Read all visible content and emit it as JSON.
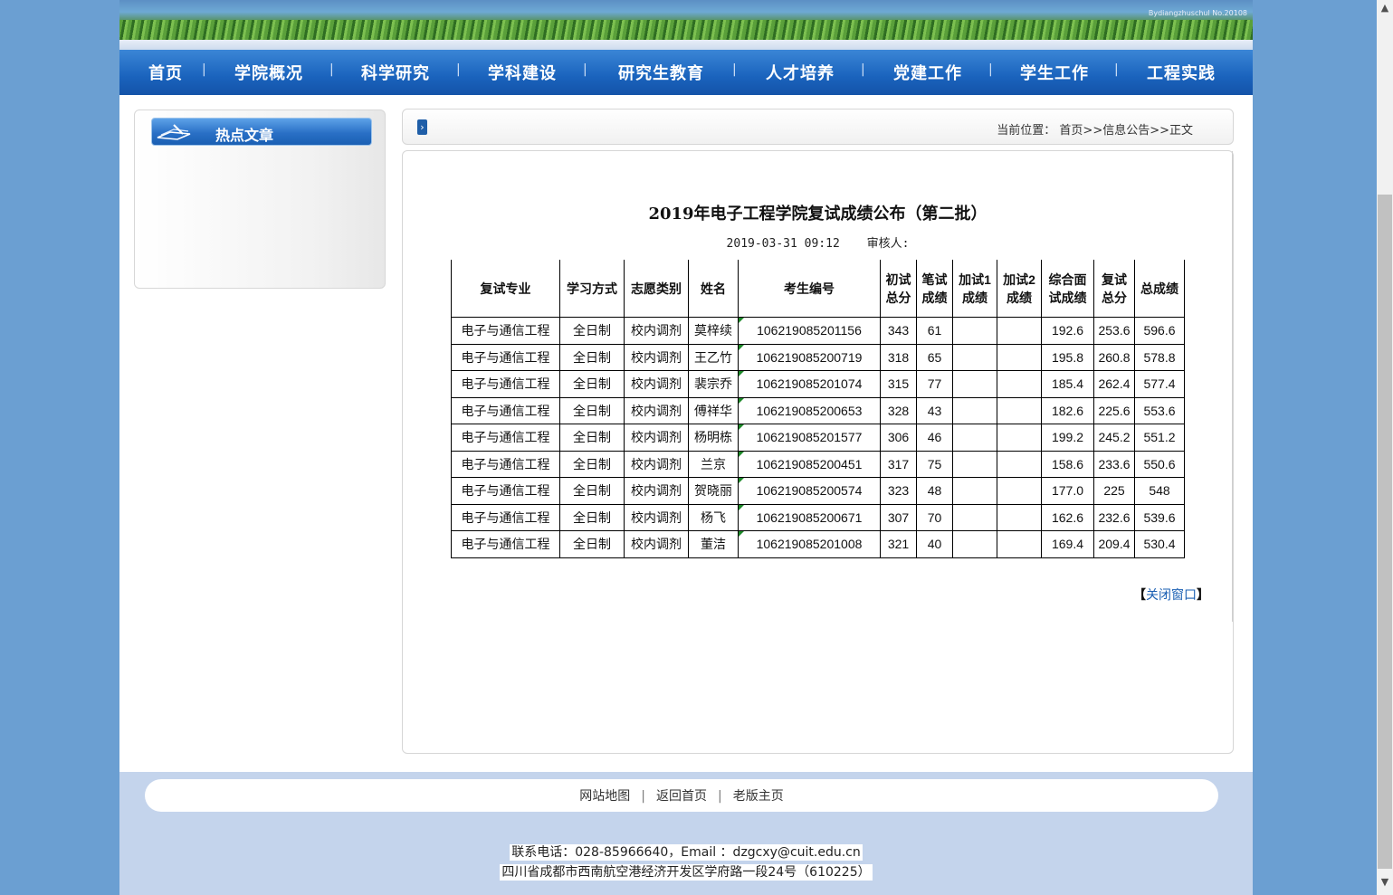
{
  "banner": {
    "tag": "Bydiangzhuschul No.20108"
  },
  "nav": {
    "items": [
      "首页",
      "学院概况",
      "科学研究",
      "学科建设",
      "研究生教育",
      "人才培养",
      "党建工作",
      "学生工作",
      "工程实践"
    ],
    "separator": "|"
  },
  "sidebar": {
    "title": "热点文章"
  },
  "breadcrumb": {
    "label": "当前位置：",
    "path": "首页>>信息公告>>正文"
  },
  "article": {
    "title": "2019年电子工程学院复试成绩公布（第二批）",
    "date": "2019-03-31 09:12",
    "reviewer": "审核人:",
    "close_open": "【",
    "close_label": "关闭窗口",
    "close_end": "】"
  },
  "table": {
    "headers": [
      "复试专业",
      "学习方式",
      "志愿类别",
      "姓名",
      "考生编号",
      "初试总分",
      "笔试成绩",
      "加试1成绩",
      "加试2成绩",
      "综合面试成绩",
      "复试总分",
      "总成绩"
    ],
    "rows": [
      [
        "电子与通信工程",
        "全日制",
        "校内调剂",
        "莫梓续",
        "106219085201156",
        "343",
        "61",
        "",
        "",
        "192.6",
        "253.6",
        "596.6"
      ],
      [
        "电子与通信工程",
        "全日制",
        "校内调剂",
        "王乙竹",
        "106219085200719",
        "318",
        "65",
        "",
        "",
        "195.8",
        "260.8",
        "578.8"
      ],
      [
        "电子与通信工程",
        "全日制",
        "校内调剂",
        "裴宗乔",
        "106219085201074",
        "315",
        "77",
        "",
        "",
        "185.4",
        "262.4",
        "577.4"
      ],
      [
        "电子与通信工程",
        "全日制",
        "校内调剂",
        "傅祥华",
        "106219085200653",
        "328",
        "43",
        "",
        "",
        "182.6",
        "225.6",
        "553.6"
      ],
      [
        "电子与通信工程",
        "全日制",
        "校内调剂",
        "杨明栋",
        "106219085201577",
        "306",
        "46",
        "",
        "",
        "199.2",
        "245.2",
        "551.2"
      ],
      [
        "电子与通信工程",
        "全日制",
        "校内调剂",
        "兰京",
        "106219085200451",
        "317",
        "75",
        "",
        "",
        "158.6",
        "233.6",
        "550.6"
      ],
      [
        "电子与通信工程",
        "全日制",
        "校内调剂",
        "贺晓丽",
        "106219085200574",
        "323",
        "48",
        "",
        "",
        "177.0",
        "225",
        "548"
      ],
      [
        "电子与通信工程",
        "全日制",
        "校内调剂",
        "杨飞",
        "106219085200671",
        "307",
        "70",
        "",
        "",
        "162.6",
        "232.6",
        "539.6"
      ],
      [
        "电子与通信工程",
        "全日制",
        "校内调剂",
        "董洁",
        "106219085201008",
        "321",
        "40",
        "",
        "",
        "169.4",
        "209.4",
        "530.4"
      ]
    ]
  },
  "footer": {
    "links": [
      "网站地图",
      "返回首页",
      "老版主页"
    ],
    "contact": "联系电话：028-85966640，Email ：dzgcxy@cuit.edu.cn",
    "address": "四川省成都市西南航空港经济开发区学府路一段24号（610225）"
  },
  "colors": {
    "nav": "#1a63bd",
    "footer": "#c4d4ec",
    "page_bg": "#6b9fd2",
    "link": "#1a5fb3"
  }
}
